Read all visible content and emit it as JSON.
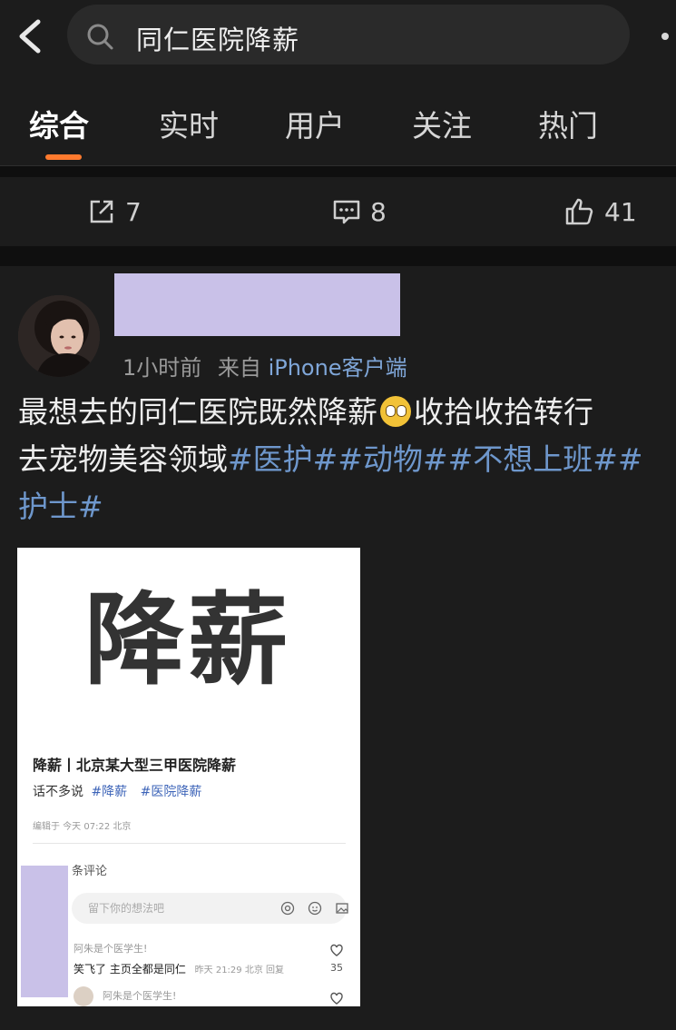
{
  "search": {
    "query": "同仁医院降薪"
  },
  "tabs": [
    {
      "label": "综合",
      "active": true
    },
    {
      "label": "实时",
      "active": false
    },
    {
      "label": "用户",
      "active": false
    },
    {
      "label": "关注",
      "active": false
    },
    {
      "label": "热门",
      "active": false
    }
  ],
  "action_bar": {
    "share_count": "7",
    "comment_count": "8",
    "like_count": "41"
  },
  "post": {
    "time": "1小时前",
    "from_label": "来自",
    "source": "iPhone客户端",
    "text_line1_a": "最想去的同仁医院既然降薪",
    "text_line1_b": "收拾收拾转行",
    "text_line2_a": "去宠物美容领域",
    "text_line2_tags": "#医护##动物##不想上班##",
    "text_line3_tag": "护士#",
    "emoji_icon": "pleading-face-icon"
  },
  "card": {
    "big_text": "降薪",
    "title": "降薪丨北京某大型三甲医院降薪",
    "body_text": "话不多说",
    "body_tag1": "#降薪",
    "body_tag2": "#医院降薪",
    "edited": "编辑于 今天 07:22 北京",
    "comments_count_label": "条评论",
    "input_placeholder": "留下你的想法吧",
    "comment1_user": "阿朱是个医学生!",
    "comment1_text": "笑飞了 主页全都是同仁",
    "comment1_time": "昨天 21:29 北京 回复",
    "comment1_likes": "35",
    "comment2_user": "阿朱是个医学生!"
  },
  "colors": {
    "accent": "#ff7a2e",
    "link": "#6e97cc",
    "background": "#1c1c1c",
    "redaction": "#c9c1e8"
  }
}
